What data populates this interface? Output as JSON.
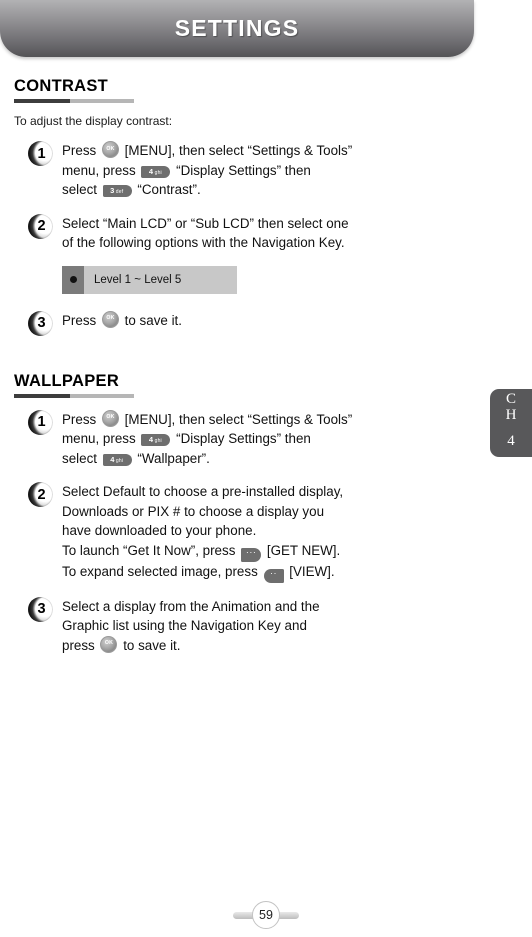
{
  "header": {
    "title": "SETTINGS"
  },
  "chapter_tab": {
    "line1": "C",
    "line2": "H",
    "number": "4"
  },
  "sections": [
    {
      "heading": "CONTRAST",
      "intro": "To adjust the display contrast:",
      "steps": [
        {
          "number": "1",
          "lines": [
            {
              "parts": [
                {
                  "type": "text",
                  "text": "Press "
                },
                {
                  "type": "key-ok",
                  "label": "OK"
                },
                {
                  "type": "text",
                  "text": " [MENU], then select “Settings & Tools”"
                }
              ]
            },
            {
              "parts": [
                {
                  "type": "text",
                  "text": "menu, press "
                },
                {
                  "type": "key-num",
                  "digit": "4",
                  "letters": "ghi"
                },
                {
                  "type": "text",
                  "text": " “Display Settings” then"
                }
              ]
            },
            {
              "parts": [
                {
                  "type": "text",
                  "text": "select "
                },
                {
                  "type": "key-num",
                  "digit": "3",
                  "letters": "def"
                },
                {
                  "type": "text",
                  "text": " “Contrast”."
                }
              ]
            }
          ]
        },
        {
          "number": "2",
          "lines": [
            {
              "parts": [
                {
                  "type": "text",
                  "text": "Select “Main LCD” or “Sub LCD” then select one"
                }
              ]
            },
            {
              "parts": [
                {
                  "type": "text",
                  "text": "of the following options with the Navigation Key."
                }
              ]
            }
          ],
          "option_box": {
            "bullet": "●",
            "label": "Level 1 ~ Level 5"
          }
        },
        {
          "number": "3",
          "lines": [
            {
              "parts": [
                {
                  "type": "text",
                  "text": "Press "
                },
                {
                  "type": "key-ok",
                  "label": "OK"
                },
                {
                  "type": "text",
                  "text": " to save it."
                }
              ]
            }
          ]
        }
      ]
    },
    {
      "heading": "WALLPAPER",
      "intro": "",
      "steps": [
        {
          "number": "1",
          "lines": [
            {
              "parts": [
                {
                  "type": "text",
                  "text": "Press "
                },
                {
                  "type": "key-ok",
                  "label": "OK"
                },
                {
                  "type": "text",
                  "text": " [MENU], then select “Settings & Tools”"
                }
              ]
            },
            {
              "parts": [
                {
                  "type": "text",
                  "text": "menu, press "
                },
                {
                  "type": "key-num",
                  "digit": "4",
                  "letters": "ghi"
                },
                {
                  "type": "text",
                  "text": " “Display Settings” then"
                }
              ]
            },
            {
              "parts": [
                {
                  "type": "text",
                  "text": "select "
                },
                {
                  "type": "key-num",
                  "digit": "4",
                  "letters": "ghi"
                },
                {
                  "type": "text",
                  "text": " “Wallpaper”."
                }
              ]
            }
          ]
        },
        {
          "number": "2",
          "lines": [
            {
              "parts": [
                {
                  "type": "text",
                  "text": "Select Default to choose a pre-installed display,"
                }
              ]
            },
            {
              "parts": [
                {
                  "type": "text",
                  "text": "Downloads or PIX # to choose a display you"
                }
              ]
            },
            {
              "parts": [
                {
                  "type": "text",
                  "text": "have downloaded to your phone."
                }
              ]
            },
            {
              "parts": [
                {
                  "type": "text",
                  "text": "To launch “Get It Now”, press "
                },
                {
                  "type": "key-soft-left",
                  "label": "···"
                },
                {
                  "type": "text",
                  "text": " [GET NEW]."
                }
              ]
            },
            {
              "parts": [
                {
                  "type": "text",
                  "text": "To expand selected image, press "
                },
                {
                  "type": "key-soft-right",
                  "label": "··"
                },
                {
                  "type": "text",
                  "text": " [VIEW]."
                }
              ]
            }
          ]
        },
        {
          "number": "3",
          "lines": [
            {
              "parts": [
                {
                  "type": "text",
                  "text": "Select a display from the Animation and the"
                }
              ]
            },
            {
              "parts": [
                {
                  "type": "text",
                  "text": "Graphic list using the Navigation Key and"
                }
              ]
            },
            {
              "parts": [
                {
                  "type": "text",
                  "text": "press "
                },
                {
                  "type": "key-ok",
                  "label": "OK"
                },
                {
                  "type": "text",
                  "text": " to save it."
                }
              ]
            }
          ]
        }
      ]
    }
  ],
  "footer": {
    "page_number": "59"
  }
}
